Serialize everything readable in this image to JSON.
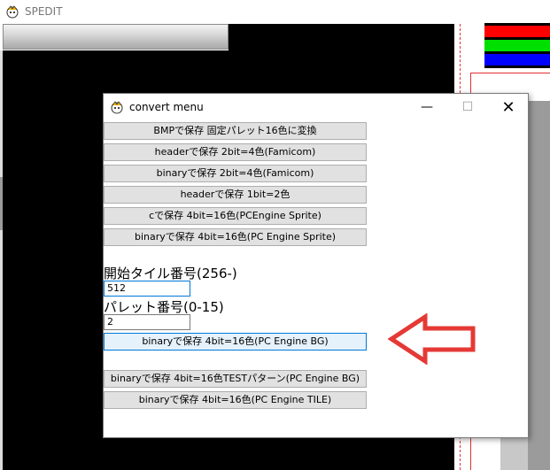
{
  "main_window": {
    "title": "SPEDIT"
  },
  "dialog": {
    "title": "convert menu",
    "window_controls": {
      "minimize": "—",
      "maximize": "☐",
      "close": "✕"
    },
    "buttons_top": [
      "BMPで保存 固定パレット16色に変換",
      "headerで保存 2bit=4色(Famicom)",
      "binaryで保存 2bit=4色(Famicom)",
      "headerで保存 1bit=2色",
      "cで保存 4bit=16色(PCEngine Sprite)",
      "binaryで保存 4bit=16色(PC Engine Sprite)"
    ],
    "start_tile": {
      "label": "開始タイル番号(256-)",
      "value": "512"
    },
    "palette": {
      "label": "パレット番号(0-15)",
      "value": "2"
    },
    "bg_button": "binaryで保存 4bit=16色(PC Engine BG)",
    "buttons_bottom": [
      "binaryで保存 4bit=16色TESTパターン(PC Engine BG)",
      "binaryで保存 4bit=16色(PC Engine TILE)"
    ]
  },
  "colors": {
    "arrow": "#e53935",
    "palette_strips": [
      "#ff0000",
      "#00e000",
      "#0000ff"
    ]
  },
  "icons": {
    "app_icon": "mascot-icon",
    "annotation_arrow": "left-arrow-icon"
  }
}
